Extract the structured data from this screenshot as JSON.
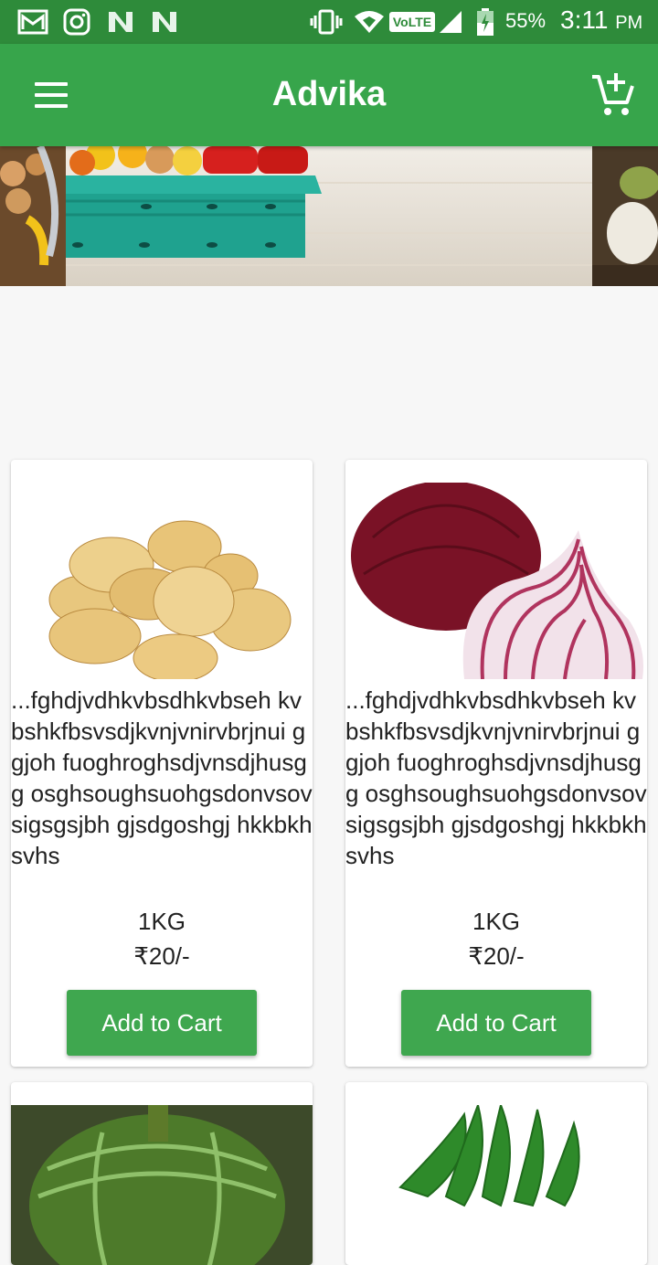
{
  "status_bar": {
    "icons": [
      "gmail-icon",
      "instagram-icon",
      "n-app-icon",
      "n-app-icon",
      "vibrate-icon",
      "wifi-icon",
      "volte-icon",
      "signal-icon",
      "battery-icon"
    ],
    "volte_label": "VoLTE",
    "battery_percent": "55%",
    "time": "3:11",
    "ampm": "PM"
  },
  "app_bar": {
    "title": "Advika",
    "menu_icon": "hamburger-menu-icon",
    "cart_icon": "add-to-cart-icon"
  },
  "colors": {
    "status_bar": "#2e8b3a",
    "primary": "#37a54b",
    "button": "#3fa74f",
    "background": "#f7f7f7"
  },
  "products": [
    {
      "image": "potatoes",
      "description": "...fghdjvdhkvbsdhkvbseh kvbshkfbsvsdjkvnjvnirvbrjnui g  gjoh fuoghroghsdjvnsdjhusgg osghsoughsuohgsdonvsov sigsgsjbh gjsdgoshgj hkkbkhsvhs",
      "quantity": "1KG",
      "price": "₹20/-",
      "button_label": "Add to Cart"
    },
    {
      "image": "red-onions",
      "description": "...fghdjvdhkvbsdhkvbseh kvbshkfbsvsdjkvnjvnirvbrjnui g  gjoh fuoghroghsdjvnsdjhusgg osghsoughsuohgsdonvsov sigsgsjbh gjsdgoshgj hkkbkhsvhs",
      "quantity": "1KG",
      "price": "₹20/-",
      "button_label": "Add to Cart"
    },
    {
      "image": "pumpkin"
    },
    {
      "image": "okra"
    }
  ]
}
